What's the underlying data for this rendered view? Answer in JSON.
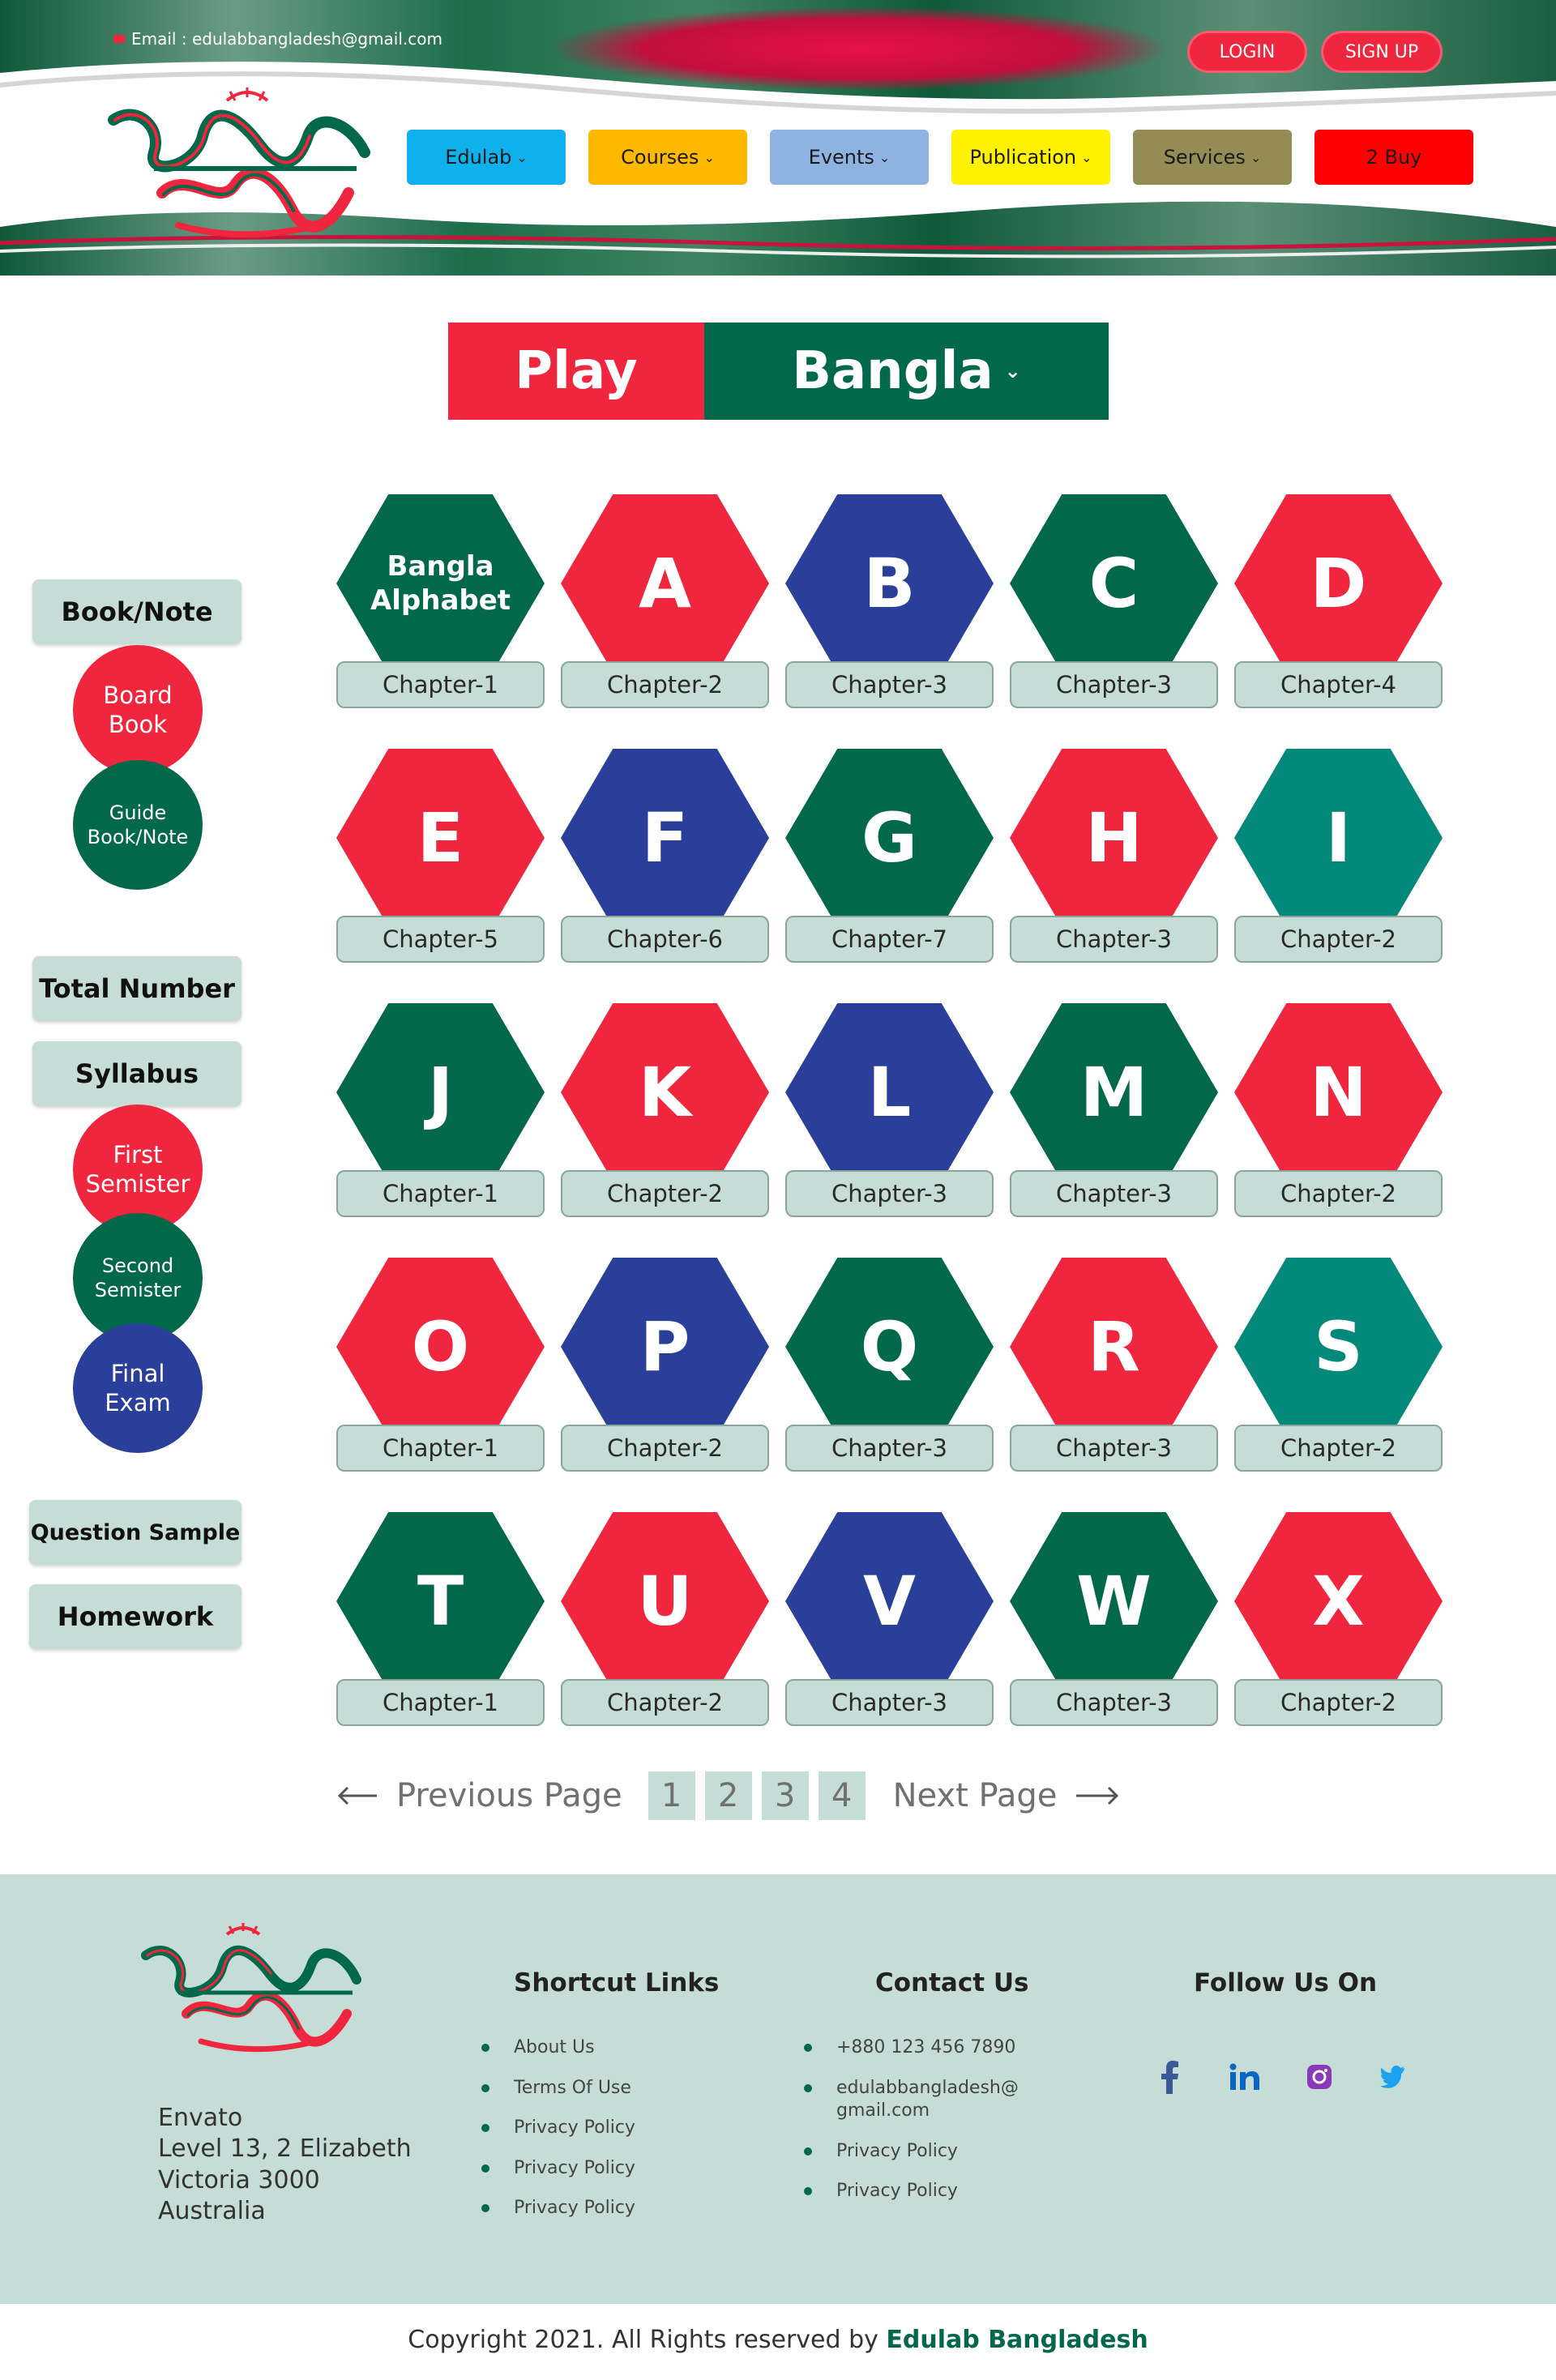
{
  "header": {
    "email": "Email : edulabbangladesh@gmail.com",
    "login": "LOGIN",
    "signup": "SIGN UP",
    "nav": [
      {
        "label": "Edulab",
        "has_dropdown": true,
        "color": "#0fb1ec"
      },
      {
        "label": "Courses",
        "has_dropdown": true,
        "color": "#ffb800"
      },
      {
        "label": "Events",
        "has_dropdown": true,
        "color": "#8fb3e1"
      },
      {
        "label": "Publication",
        "has_dropdown": true,
        "color": "#fff200"
      },
      {
        "label": "Services",
        "has_dropdown": true,
        "color": "#948b55"
      },
      {
        "label": "2 Buy",
        "has_dropdown": false,
        "color": "#ff0000"
      }
    ]
  },
  "play": {
    "left": "Play",
    "right": "Bangla"
  },
  "sidebar": {
    "book_note": "Book/Note",
    "board_book": "Board Book",
    "guide_book": "Guide Book/Note",
    "total_number": "Total Number",
    "syllabus": "Syllabus",
    "first_semister": "First Semister",
    "second_semister": "Second Semister",
    "final_exam": "Final Exam",
    "question_sample": "Question Sample",
    "homework": "Homework"
  },
  "grid": [
    {
      "letter": "Bangla Alphabet",
      "chapter": "Chapter-1",
      "color": "green"
    },
    {
      "letter": "A",
      "chapter": "Chapter-2",
      "color": "red"
    },
    {
      "letter": "B",
      "chapter": "Chapter-3",
      "color": "blue"
    },
    {
      "letter": "C",
      "chapter": "Chapter-3",
      "color": "green"
    },
    {
      "letter": "D",
      "chapter": "Chapter-4",
      "color": "red"
    },
    {
      "letter": "E",
      "chapter": "Chapter-5",
      "color": "red"
    },
    {
      "letter": "F",
      "chapter": "Chapter-6",
      "color": "blue"
    },
    {
      "letter": "G",
      "chapter": "Chapter-7",
      "color": "green"
    },
    {
      "letter": "H",
      "chapter": "Chapter-3",
      "color": "red"
    },
    {
      "letter": "I",
      "chapter": "Chapter-2",
      "color": "teal"
    },
    {
      "letter": "J",
      "chapter": "Chapter-1",
      "color": "green"
    },
    {
      "letter": "K",
      "chapter": "Chapter-2",
      "color": "red"
    },
    {
      "letter": "L",
      "chapter": "Chapter-3",
      "color": "blue"
    },
    {
      "letter": "M",
      "chapter": "Chapter-3",
      "color": "green"
    },
    {
      "letter": "N",
      "chapter": "Chapter-2",
      "color": "red"
    },
    {
      "letter": "O",
      "chapter": "Chapter-1",
      "color": "red"
    },
    {
      "letter": "P",
      "chapter": "Chapter-2",
      "color": "blue"
    },
    {
      "letter": "Q",
      "chapter": "Chapter-3",
      "color": "green"
    },
    {
      "letter": "R",
      "chapter": "Chapter-3",
      "color": "red"
    },
    {
      "letter": "S",
      "chapter": "Chapter-2",
      "color": "teal"
    },
    {
      "letter": "T",
      "chapter": "Chapter-1",
      "color": "green"
    },
    {
      "letter": "U",
      "chapter": "Chapter-2",
      "color": "red"
    },
    {
      "letter": "V",
      "chapter": "Chapter-3",
      "color": "blue"
    },
    {
      "letter": "W",
      "chapter": "Chapter-3",
      "color": "green"
    },
    {
      "letter": "X",
      "chapter": "Chapter-2",
      "color": "red"
    }
  ],
  "pagination": {
    "prev": "Previous Page",
    "next": "Next Page",
    "pages": [
      "1",
      "2",
      "3",
      "4"
    ]
  },
  "footer": {
    "address": [
      "Envato",
      "Level 13, 2 Elizabeth",
      "Victoria 3000",
      "Australia"
    ],
    "shortcut_title": "Shortcut Links",
    "shortcut_links": [
      "About Us",
      "Terms Of Use",
      "Privacy Policy",
      "Privacy Policy",
      "Privacy Policy"
    ],
    "contact_title": "Contact Us",
    "contact_items": [
      "+880 123 456 7890",
      "edulabbangladesh@\ngmail.com",
      "Privacy Policy",
      "Privacy Policy"
    ],
    "follow_title": "Follow Us On",
    "social": [
      "facebook-icon",
      "linkedin-icon",
      "instagram-icon",
      "twitter-icon"
    ],
    "copyright_prefix": "Copyright 2021. All Rights reserved by ",
    "copyright_brand": "Edulab Bangladesh"
  },
  "colors": {
    "red": "#f0263f",
    "green": "#02684a",
    "blue": "#2a3f9a",
    "teal": "#03897a",
    "mint": "#c5ddd6"
  }
}
